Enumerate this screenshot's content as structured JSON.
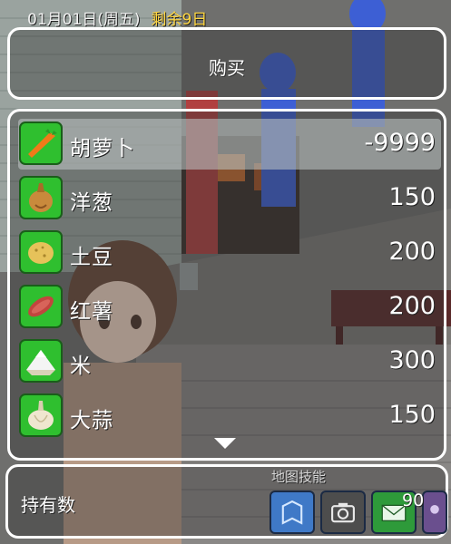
{
  "hud": {
    "date": "01月01日(周五)",
    "days_left": "剩余9日"
  },
  "buy_panel": {
    "title": "购买"
  },
  "items": [
    {
      "name": "胡萝卜",
      "value": "-9999",
      "icon": "carrot-icon",
      "selected": true
    },
    {
      "name": "洋葱",
      "value": "150",
      "icon": "onion-icon",
      "selected": false
    },
    {
      "name": "土豆",
      "value": "200",
      "icon": "potato-icon",
      "selected": false
    },
    {
      "name": "红薯",
      "value": "200",
      "icon": "sweet-potato-icon",
      "selected": false
    },
    {
      "name": "米",
      "value": "300",
      "icon": "rice-icon",
      "selected": false
    },
    {
      "name": "大蒜",
      "value": "150",
      "icon": "garlic-icon",
      "selected": false
    }
  ],
  "footer": {
    "held_label": "持有数",
    "skill_label": "地图技能",
    "count": "90",
    "skills": [
      "map-icon",
      "camera-icon",
      "mail-icon",
      "extra-skill-icon"
    ]
  },
  "colors": {
    "panel_border": "#ffffff",
    "icon_bg": "#2fbf2f",
    "days_left": "#ffd640"
  }
}
